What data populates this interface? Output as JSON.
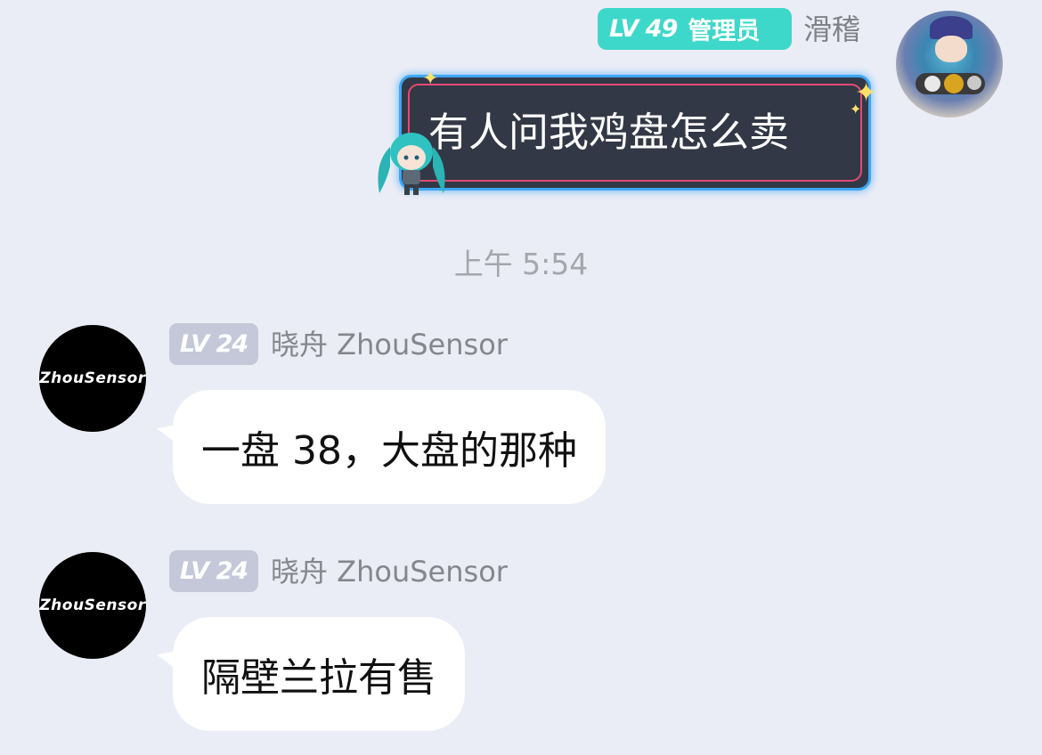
{
  "outgoing": {
    "avatar_icon": "plush-figure-avatar",
    "badge": {
      "level": "LV 49",
      "role": "管理员",
      "color": "#3dd8c9"
    },
    "sender": "滑稽",
    "text": "有人问我鸡盘怎么卖",
    "bubble_colors": {
      "fill": "#323845",
      "outer_border": "#3ea6f5",
      "inner_border": "#e44a74"
    },
    "sticker_icon": "miku-chibi-sticker"
  },
  "timestamp": "上午 5:54",
  "incoming": [
    {
      "avatar_label": "ZhouSensor",
      "level": "LV 24",
      "sender": "晓舟 ZhouSensor",
      "text": "一盘 38，大盘的那种"
    },
    {
      "avatar_label": "ZhouSensor",
      "level": "LV 24",
      "sender": "晓舟 ZhouSensor",
      "text": "隔壁兰拉有售"
    }
  ]
}
